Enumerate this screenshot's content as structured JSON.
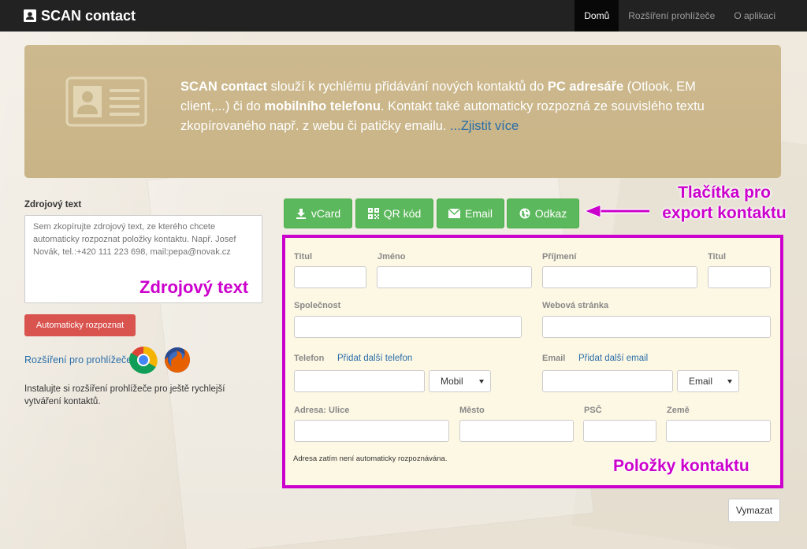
{
  "navbar": {
    "brand": "SCAN contact",
    "items": [
      {
        "label": "Domů",
        "active": true
      },
      {
        "label": "Rozšíření prohlížeče",
        "active": false
      },
      {
        "label": "O aplikaci",
        "active": false
      }
    ]
  },
  "hero": {
    "brand_bold": "SCAN contact",
    "t1": " slouží k rychlému přidávání nových kontaktů do ",
    "pc": "PC adresáře",
    "t2": " (Otlook, EM client,...) či do ",
    "mobile": "mobilního telefonu",
    "t3": ". Kontakt také automaticky rozpozná ze souvislého textu zkopírovaného např. z webu či patičky emailu. ",
    "more_link": "...Zjistit více"
  },
  "source": {
    "label": "Zdrojový text",
    "placeholder": "Sem zkopírujte zdrojový text, ze kterého chcete automaticky rozpoznat položky kontaktu. Např. Josef Novák, tel.:+420 111 223 698, mail:pepa@novak.cz",
    "recognize_button": "Automaticky rozpoznat",
    "extension_link": "Rozšíření pro prohlížeče",
    "extension_note": "Instalujte si rozšíření prohlížeče pro ještě rychlejší vytváření kontaktů."
  },
  "export": {
    "vcard": "vCard",
    "qr": "QR kód",
    "email": "Email",
    "link": "Odkaz"
  },
  "annotations": {
    "export_line1": "Tlačítka pro",
    "export_line2": "export kontaktu",
    "source_text": "Zdrojový text",
    "contact_items": "Položky kontaktu"
  },
  "form": {
    "title_before": "Titul",
    "first_name": "Jméno",
    "last_name": "Příjmení",
    "title_after": "Titul",
    "company": "Společnost",
    "website": "Webová stránka",
    "phone": "Telefon",
    "add_phone": "Přidat další telefon",
    "phone_type": "Mobil",
    "email": "Email",
    "add_email": "Přidat další email",
    "email_type": "Email",
    "street": "Adresa: Ulice",
    "city": "Město",
    "zip": "PSČ",
    "country": "Země",
    "address_note": "Adresa zatím není automaticky rozpoznávána.",
    "clear_button": "Vymazat"
  },
  "colors": {
    "navbar": "#222222",
    "hero": "#c9b68a",
    "green": "#5cb85c",
    "red": "#d9534f",
    "annotation": "#cc00cc",
    "link": "#2a6ea8"
  }
}
